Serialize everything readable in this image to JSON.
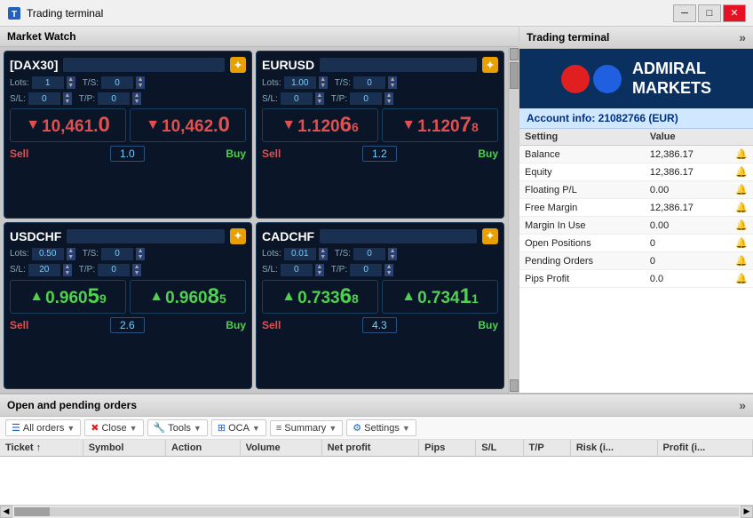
{
  "titleBar": {
    "title": "Trading terminal",
    "minBtn": "─",
    "maxBtn": "□",
    "closeBtn": "✕"
  },
  "marketWatch": {
    "title": "Market Watch",
    "cards": [
      {
        "symbol": "[DAX30]",
        "lots_label": "Lots:",
        "lots_value": "1",
        "ts_label": "T/S:",
        "ts_value": "0",
        "sl_label": "S/L:",
        "sl_value": "0",
        "tp_label": "T/P:",
        "tp_value": "0",
        "sell_price_prefix": "10,461.",
        "sell_price_big": "0",
        "buy_price_prefix": "10,462.",
        "buy_price_big": "0",
        "sell_label": "Sell",
        "spread": "1.0",
        "buy_label": "Buy",
        "sell_direction": "down",
        "buy_direction": "down"
      },
      {
        "symbol": "EURUSD",
        "lots_label": "Lots:",
        "lots_value": "1.00",
        "ts_label": "T/S:",
        "ts_value": "0",
        "sl_label": "S/L:",
        "sl_value": "0",
        "tp_label": "T/P:",
        "tp_value": "0",
        "sell_price_prefix": "1.120",
        "sell_price_big": "66",
        "buy_price_prefix": "1.120",
        "buy_price_big": "78",
        "sell_label": "Sell",
        "spread": "1.2",
        "buy_label": "Buy",
        "sell_direction": "down",
        "buy_direction": "down"
      },
      {
        "symbol": "USDCHF",
        "lots_label": "Lots:",
        "lots_value": "0.50",
        "ts_label": "T/S:",
        "ts_value": "0",
        "sl_label": "S/L:",
        "sl_value": "20",
        "tp_label": "T/P:",
        "tp_value": "0",
        "sell_price_prefix": "0.960",
        "sell_price_big": "59",
        "buy_price_prefix": "0.960",
        "buy_price_big": "85",
        "sell_label": "Sell",
        "spread": "2.6",
        "buy_label": "Buy",
        "sell_direction": "up",
        "buy_direction": "up"
      },
      {
        "symbol": "CADCHF",
        "lots_label": "Lots:",
        "lots_value": "0.01",
        "ts_label": "T/S:",
        "ts_value": "0",
        "sl_label": "S/L:",
        "sl_value": "0",
        "tp_label": "T/P:",
        "tp_value": "0",
        "sell_price_prefix": "0.733",
        "sell_price_big": "68",
        "buy_price_prefix": "0.734",
        "buy_price_big": "11",
        "sell_label": "Sell",
        "spread": "4.3",
        "buy_label": "Buy",
        "sell_direction": "up",
        "buy_direction": "up"
      }
    ]
  },
  "rightPanel": {
    "title": "Trading terminal",
    "expandLabel": "»",
    "logo": {
      "line1": "ADMIRAL",
      "line2": "MARKETS"
    },
    "accountInfo": {
      "header": "Account info: 21082766 (EUR)",
      "columns": [
        "Setting",
        "Value"
      ],
      "rows": [
        {
          "setting": "Balance",
          "value": "12,386.17"
        },
        {
          "setting": "Equity",
          "value": "12,386.17"
        },
        {
          "setting": "Floating P/L",
          "value": "0.00"
        },
        {
          "setting": "Free Margin",
          "value": "12,386.17"
        },
        {
          "setting": "Margin In Use",
          "value": "0.00"
        },
        {
          "setting": "Open Positions",
          "value": "0"
        },
        {
          "setting": "Pending Orders",
          "value": "0"
        },
        {
          "setting": "Pips Profit",
          "value": "0.0"
        }
      ]
    }
  },
  "bottomSection": {
    "title": "Open and pending orders",
    "expandLabel": "»",
    "toolbar": {
      "allOrders": "All orders",
      "close": "Close",
      "tools": "Tools",
      "oca": "OCA",
      "summary": "Summary",
      "settings": "Settings"
    },
    "table": {
      "columns": [
        "Ticket ↑",
        "Symbol",
        "Action",
        "Volume",
        "Net profit",
        "Pips",
        "S/L",
        "T/P",
        "Risk (i...",
        "Profit (i..."
      ]
    }
  }
}
